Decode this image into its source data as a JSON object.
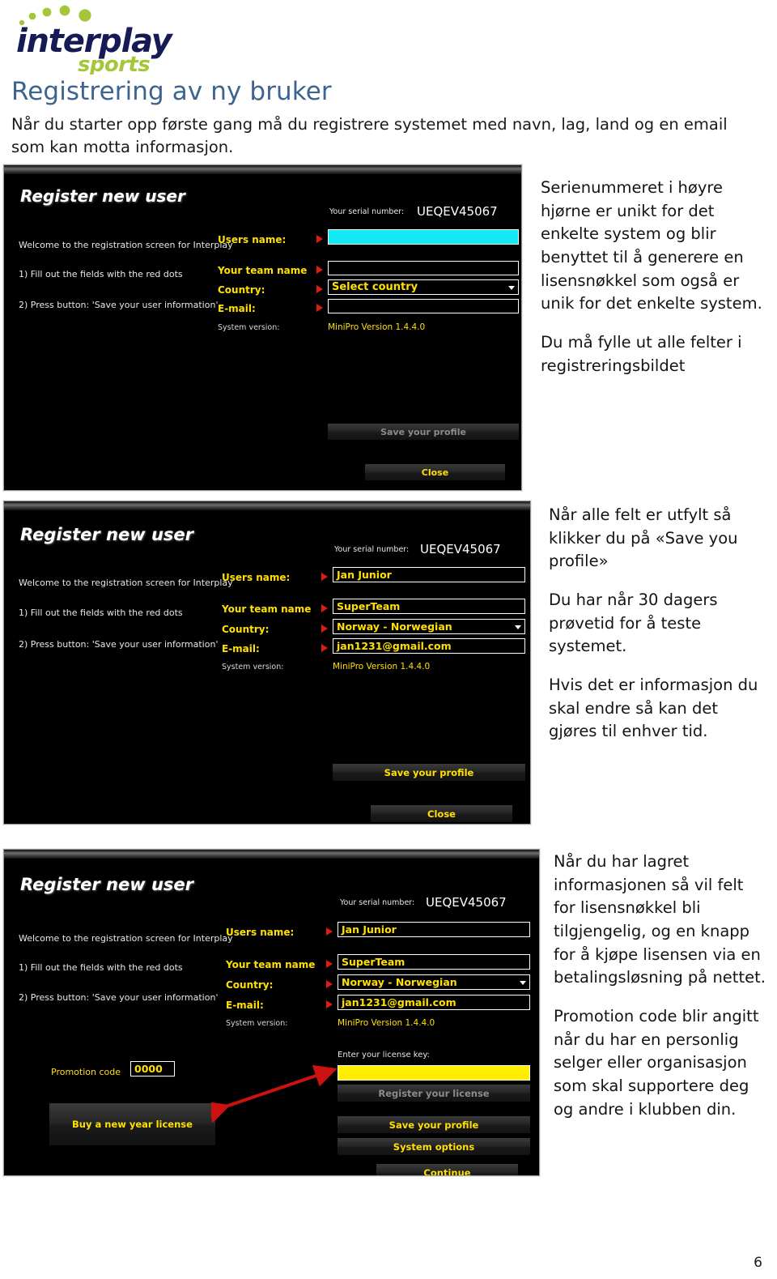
{
  "brand": {
    "name_main": "interplay",
    "name_sub": "sports",
    "color_main": "#161b56",
    "color_sub": "#a5c63b"
  },
  "document": {
    "title": "Registrering av ny bruker",
    "title_color": "#3d6491",
    "intro": "Når du starter opp første gang må du registrere systemet med navn, lag, land og en email som kan motta informasjon.",
    "page_number": "6"
  },
  "shots": [
    {
      "app_title": "Register new user",
      "left_lines": [
        "Welcome to the registration screen for Interplay",
        "1) Fill out the fields with the red dots",
        "2) Press button: 'Save your user information'"
      ],
      "serial_label": "Your serial number:",
      "serial_value": "UEQEV45067",
      "fields": [
        {
          "label": "Users name:",
          "value": "",
          "required": true
        },
        {
          "label": "Your team name",
          "value": "",
          "required": true
        },
        {
          "label": "Country:",
          "value": "Select country",
          "required": true
        },
        {
          "label": "E-mail:",
          "value": "",
          "required": true
        }
      ],
      "sysver_label": "System version:",
      "sysver_value": "MiniPro Version 1.4.4.0",
      "buttons": {
        "save": "Save your profile",
        "close": "Close"
      }
    },
    {
      "app_title": "Register new user",
      "left_lines": [
        "Welcome to the registration screen for Interplay",
        "1) Fill out the fields with the red dots",
        "2) Press button: 'Save your user information'"
      ],
      "serial_label": "Your serial number:",
      "serial_value": "UEQEV45067",
      "fields": [
        {
          "label": "Users name:",
          "value": "Jan Junior",
          "required": true
        },
        {
          "label": "Your team name",
          "value": "SuperTeam",
          "required": true
        },
        {
          "label": "Country:",
          "value": "Norway - Norwegian",
          "required": true
        },
        {
          "label": "E-mail:",
          "value": "jan1231@gmail.com",
          "required": true
        }
      ],
      "sysver_label": "System version:",
      "sysver_value": "MiniPro Version 1.4.4.0",
      "buttons": {
        "save": "Save your profile",
        "close": "Close"
      }
    },
    {
      "app_title": "Register new user",
      "left_lines": [
        "Welcome to the registration screen for Interplay",
        "1) Fill out the fields with the red dots",
        "2) Press button: 'Save your user information'"
      ],
      "serial_label": "Your serial number:",
      "serial_value": "UEQEV45067",
      "fields": [
        {
          "label": "Users name:",
          "value": "Jan Junior",
          "required": true
        },
        {
          "label": "Your team name",
          "value": "SuperTeam",
          "required": true
        },
        {
          "label": "Country:",
          "value": "Norway - Norwegian",
          "required": true
        },
        {
          "label": "E-mail:",
          "value": "jan1231@gmail.com",
          "required": true
        }
      ],
      "sysver_label": "System version:",
      "sysver_value": "MiniPro Version 1.4.4.0",
      "promotion": {
        "label": "Promotion code",
        "value": "0000"
      },
      "license": {
        "label": "Enter your license key:",
        "value": ""
      },
      "buttons": {
        "buy": "Buy a new year license",
        "register_license": "Register your license",
        "save": "Save your profile",
        "system_options": "System options",
        "continue": "Continue"
      }
    }
  ],
  "notes": [
    {
      "paragraphs": [
        "Serienummeret i høyre hjørne er unikt for det enkelte system og blir benyttet til å generere en lisensnøkkel som også er unik for det enkelte system.",
        "Du må fylle ut alle felter i registreringsbildet"
      ]
    },
    {
      "paragraphs": [
        "Når alle felt er utfylt så klikker du på «Save you profile»",
        "Du har når 30 dagers prøvetid for å teste systemet.",
        "Hvis det er informasjon du skal endre så kan det gjøres til enhver tid."
      ]
    },
    {
      "paragraphs": [
        "Når du har lagret informasjonen så vil felt for lisensnøkkel bli tilgjengelig, og en knapp for å kjøpe lisensen via en betalingsløsning på nettet.",
        "Promotion code blir angitt når du har en personlig selger eller organisasjon som skal supportere deg og andre i klubben din."
      ]
    }
  ],
  "colors": {
    "yellow": "#ffe000",
    "red_marker": "#e01b10",
    "cyan_field": "#13e9f5",
    "license_field": "#ffee00",
    "arrow": "#cc1111"
  }
}
